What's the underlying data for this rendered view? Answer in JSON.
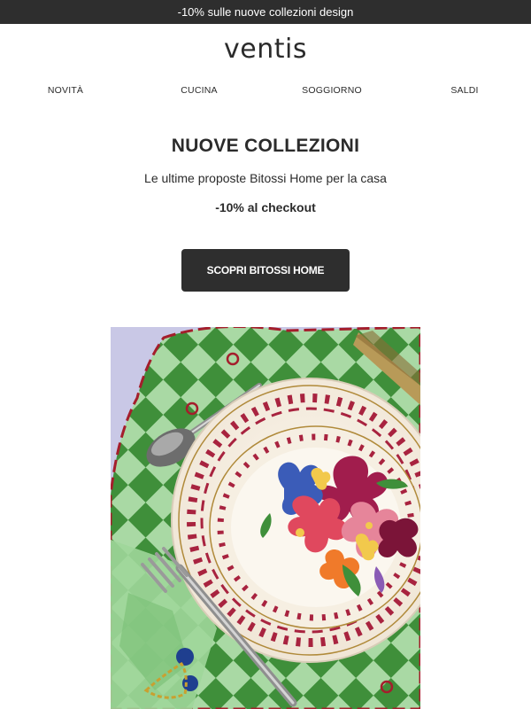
{
  "promo": {
    "text": "-10% sulle nuove collezioni design"
  },
  "brand": {
    "logo": "ventis"
  },
  "nav": {
    "items": [
      {
        "label": "NOVITÀ"
      },
      {
        "label": "CUCINA"
      },
      {
        "label": "SOGGIORNO"
      },
      {
        "label": "SALDI"
      }
    ]
  },
  "hero": {
    "title": "NUOVE COLLEZIONI",
    "subtitle": "Le ultime proposte Bitossi Home per la casa",
    "discount": "-10% al checkout",
    "cta_label": "SCOPRI BITOSSI HOME"
  },
  "colors": {
    "dark": "#2e2e2e",
    "text": "#2b2b2b",
    "background": "#ffffff",
    "check_green": "#3f8f3a",
    "check_light": "#a9d9a4",
    "plate_red": "#a8233f"
  }
}
